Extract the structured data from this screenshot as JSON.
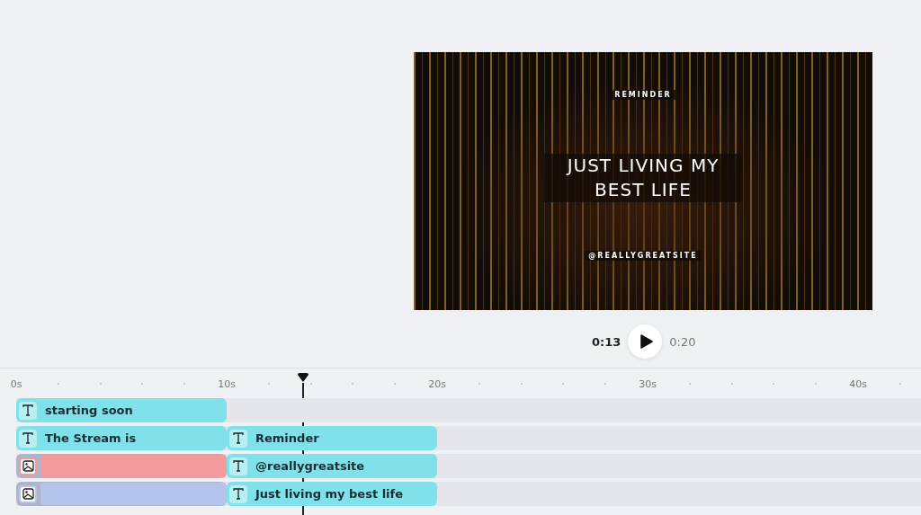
{
  "preview": {
    "label": "REMINDER",
    "headline": "JUST LIVING MY BEST LIFE",
    "handle": "@REALLYGREATSITE"
  },
  "playback": {
    "current": "0:13",
    "total": "0:20",
    "playing": false
  },
  "ruler": [
    "0s",
    "10s",
    "20s",
    "30s",
    "40s"
  ],
  "tracks": [
    {
      "clips": [
        {
          "kind": "text",
          "label": "starting soon"
        }
      ]
    },
    {
      "clips": [
        {
          "kind": "text",
          "label": "The Stream is"
        },
        {
          "kind": "text",
          "label": "Reminder"
        }
      ]
    },
    {
      "clips": [
        {
          "kind": "image",
          "color": "#f29a9c"
        },
        {
          "kind": "text",
          "label": "@reallygreatsite"
        }
      ]
    },
    {
      "clips": [
        {
          "kind": "image",
          "color": "#b4c4ec"
        },
        {
          "kind": "text",
          "label": "Just living my best life"
        }
      ]
    }
  ]
}
